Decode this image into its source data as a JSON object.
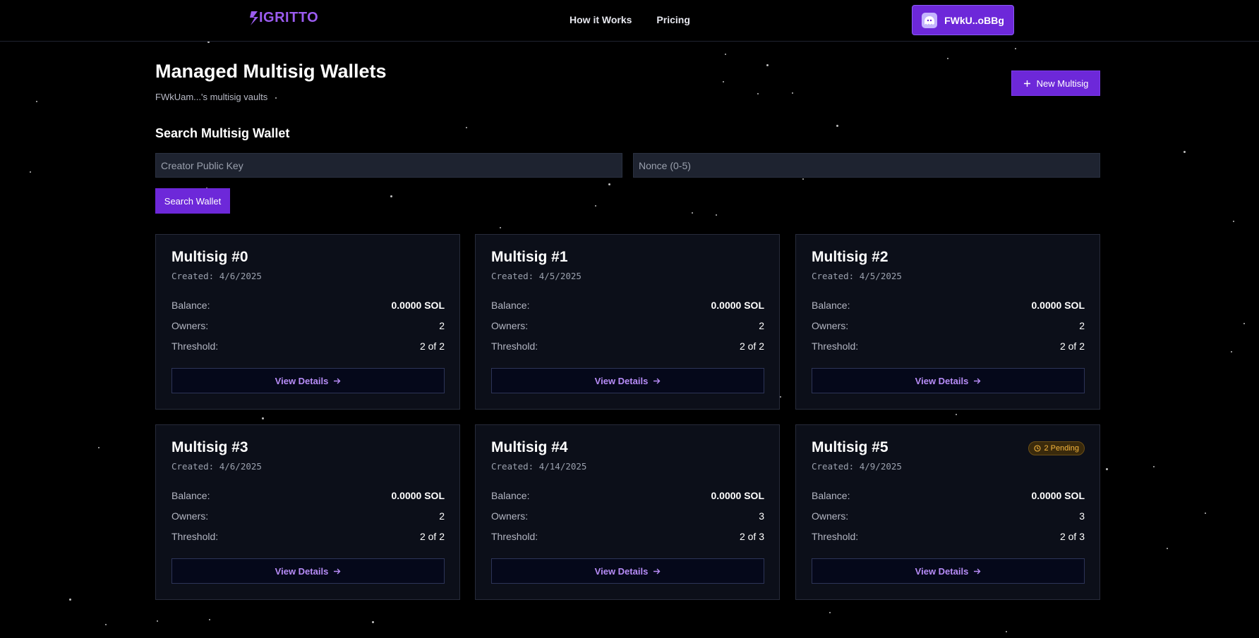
{
  "navbar": {
    "logo": "IGRITTO",
    "links": [
      "How it Works",
      "Pricing"
    ],
    "wallet": "FWkU..oBBg"
  },
  "header": {
    "title": "Managed Multisig Wallets",
    "subtitle": "FWkUam...'s multisig vaults",
    "new_button": "New Multisig"
  },
  "search": {
    "title": "Search Multisig Wallet",
    "creator_placeholder": "Creator Public Key",
    "nonce_placeholder": "Nonce (0-5)",
    "button": "Search Wallet"
  },
  "labels": {
    "balance": "Balance:",
    "owners": "Owners:",
    "threshold": "Threshold:",
    "view": "View Details"
  },
  "wallets": [
    {
      "title": "Multisig #0",
      "created": "Created: 4/6/2025",
      "balance": "0.0000 SOL",
      "owners": "2",
      "threshold": "2 of 2",
      "badge": ""
    },
    {
      "title": "Multisig #1",
      "created": "Created: 4/5/2025",
      "balance": "0.0000 SOL",
      "owners": "2",
      "threshold": "2 of 2",
      "badge": ""
    },
    {
      "title": "Multisig #2",
      "created": "Created: 4/5/2025",
      "balance": "0.0000 SOL",
      "owners": "2",
      "threshold": "2 of 2",
      "badge": ""
    },
    {
      "title": "Multisig #3",
      "created": "Created: 4/6/2025",
      "balance": "0.0000 SOL",
      "owners": "2",
      "threshold": "2 of 2",
      "badge": ""
    },
    {
      "title": "Multisig #4",
      "created": "Created: 4/14/2025",
      "balance": "0.0000 SOL",
      "owners": "3",
      "threshold": "2 of 3",
      "badge": ""
    },
    {
      "title": "Multisig #5",
      "created": "Created: 4/9/2025",
      "balance": "0.0000 SOL",
      "owners": "3",
      "threshold": "2 of 3",
      "badge": "2 Pending"
    }
  ],
  "colors": {
    "accent": "#6d28d9",
    "link": "#b78cf7",
    "background": "#000000",
    "card": "#0d101a",
    "pending": "#f5b53d"
  },
  "icons": {
    "logo": "lightning-s-icon",
    "wallet": "ghost-wallet-icon",
    "plus": "plus-icon",
    "arrow": "arrow-right-icon",
    "clock": "clock-icon"
  }
}
